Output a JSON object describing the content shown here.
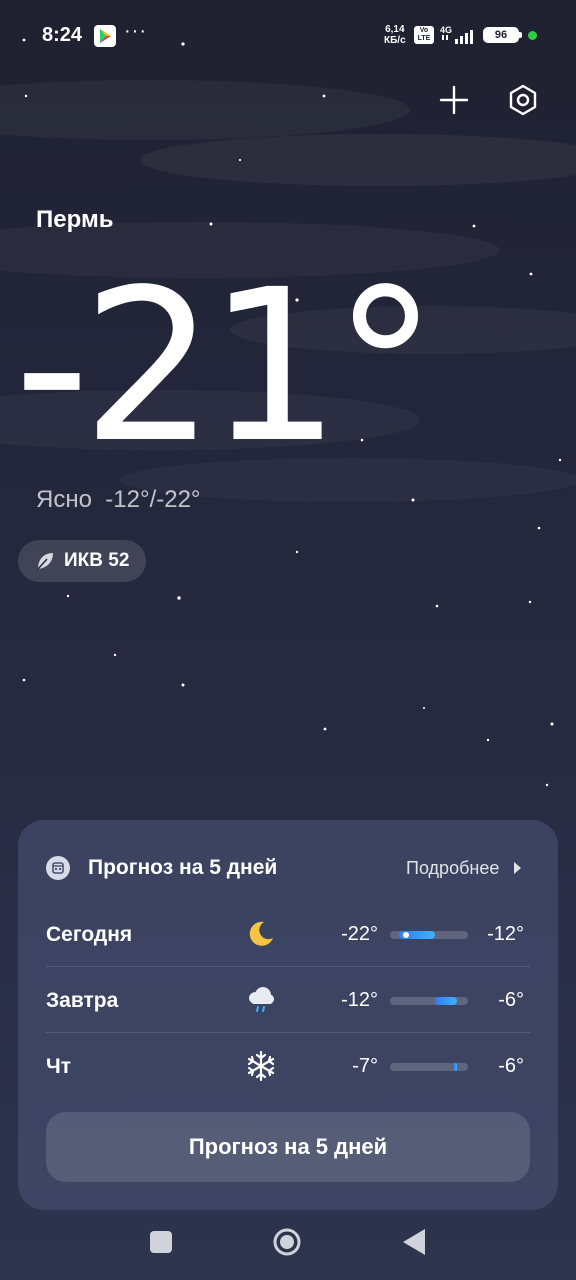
{
  "status_bar": {
    "time": "8:24",
    "more_indicator": "···",
    "net_speed_value": "6,14",
    "net_speed_unit": "КБ/с",
    "volte_top": "Vo",
    "volte_bottom": "LTE",
    "network_type": "4G",
    "battery_level": "96",
    "icons": [
      "play-store-icon",
      "volte-icon",
      "signal-icon",
      "battery-icon"
    ]
  },
  "toolbar": {
    "add_icon": "plus-icon",
    "settings_icon": "gear-icon"
  },
  "weather": {
    "city": "Пермь",
    "temperature": "-21°",
    "condition": "Ясно",
    "range": "-12°/-22°",
    "aqi_label": "ИКВ 52"
  },
  "forecast": {
    "title": "Прогноз на 5 дней",
    "more_label": "Подробнее",
    "days": [
      {
        "day": "Сегодня",
        "icon": "moon-icon",
        "low": "-22°",
        "high": "-12°",
        "bar_start": 0.12,
        "bar_end": 0.58,
        "dot": 0.2
      },
      {
        "day": "Завтра",
        "icon": "rain-cloud-icon",
        "low": "-12°",
        "high": "-6°",
        "bar_start": 0.58,
        "bar_end": 0.86,
        "dot": null
      },
      {
        "day": "Чт",
        "icon": "snowflake-icon",
        "low": "-7°",
        "high": "-6°",
        "bar_start": 0.82,
        "bar_end": 0.86,
        "dot": null
      }
    ],
    "button_label": "Прогноз на 5 дней"
  },
  "colors": {
    "background_top": "#1f2130",
    "background_bottom": "#2e344d",
    "bar_start": "#2e7dff",
    "bar_end": "#3fb1ff",
    "moon": "#f5c542",
    "battery_dot": "#2ecc40"
  }
}
